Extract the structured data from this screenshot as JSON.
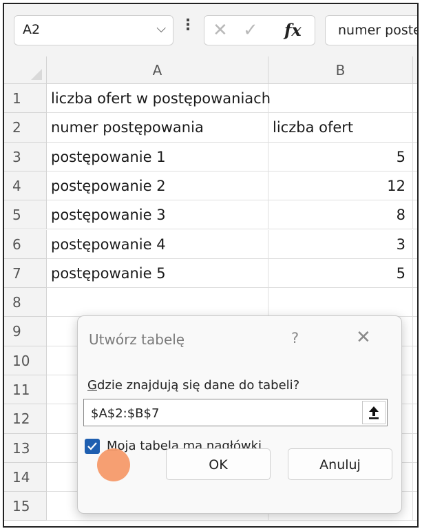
{
  "formula_bar": {
    "name_box": "A2",
    "cancel_glyph": "✕",
    "enter_glyph": "✓",
    "fx_label": "fx",
    "content": "numer postępowania"
  },
  "columns": [
    "A",
    "B"
  ],
  "rows": [
    {
      "n": "1",
      "a": "liczba ofert w postępowaniach",
      "b": ""
    },
    {
      "n": "2",
      "a": "numer postępowania",
      "b": "liczba ofert"
    },
    {
      "n": "3",
      "a": "postępowanie 1",
      "b": "5"
    },
    {
      "n": "4",
      "a": "postępowanie 2",
      "b": "12"
    },
    {
      "n": "5",
      "a": "postępowanie 3",
      "b": "8"
    },
    {
      "n": "6",
      "a": "postępowanie 4",
      "b": "3"
    },
    {
      "n": "7",
      "a": "postępowanie 5",
      "b": "5"
    },
    {
      "n": "8",
      "a": "",
      "b": ""
    },
    {
      "n": "9",
      "a": "",
      "b": ""
    },
    {
      "n": "10",
      "a": "",
      "b": ""
    },
    {
      "n": "11",
      "a": "",
      "b": ""
    },
    {
      "n": "12",
      "a": "",
      "b": ""
    },
    {
      "n": "13",
      "a": "",
      "b": ""
    },
    {
      "n": "14",
      "a": "",
      "b": ""
    },
    {
      "n": "15",
      "a": "",
      "b": ""
    }
  ],
  "dialog": {
    "title": "Utwórz tabelę",
    "help_glyph": "?",
    "close_glyph": "✕",
    "question_access": "G",
    "question_rest": "dzie znajdują się dane do tabeli?",
    "range": "$A$2:$B$7",
    "headers_checked": true,
    "checkbox_access": "M",
    "checkbox_rest": "oja tabela ma nagłówki",
    "ok_label": "OK",
    "cancel_label": "Anuluj"
  }
}
